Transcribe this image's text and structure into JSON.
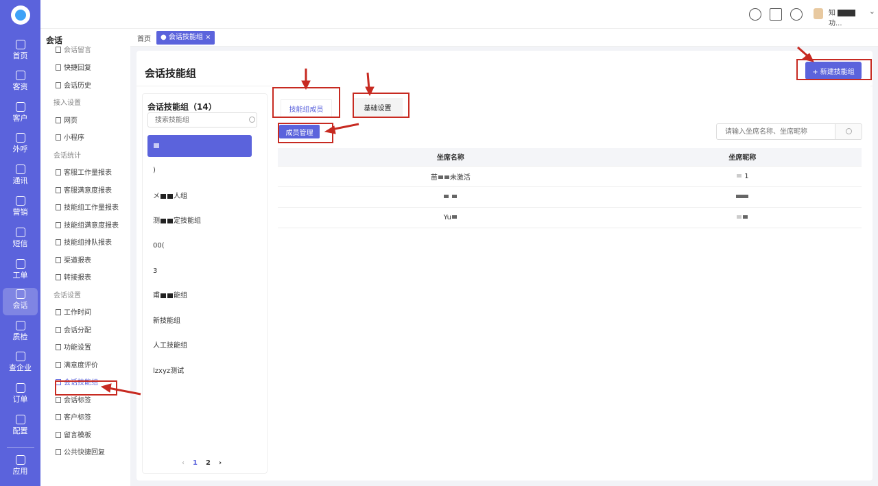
{
  "rail": {
    "items": [
      {
        "label": "首页",
        "icon": "home-icon"
      },
      {
        "label": "客资",
        "icon": "customers-icon"
      },
      {
        "label": "客户",
        "icon": "customer-icon"
      },
      {
        "label": "外呼",
        "icon": "phone-icon"
      },
      {
        "label": "通讯",
        "icon": "contacts-icon"
      },
      {
        "label": "营销",
        "icon": "marketing-icon"
      },
      {
        "label": "短信",
        "icon": "sms-icon"
      },
      {
        "label": "工单",
        "icon": "ticket-icon"
      },
      {
        "label": "会话",
        "icon": "chat-icon"
      },
      {
        "label": "质检",
        "icon": "quality-icon"
      },
      {
        "label": "查企业",
        "icon": "company-icon"
      },
      {
        "label": "订单",
        "icon": "order-icon"
      },
      {
        "label": "配置",
        "icon": "config-icon"
      },
      {
        "label": "应用",
        "icon": "apps-icon"
      }
    ],
    "active_index": 8
  },
  "topbar": {
    "user_suffix": "功...",
    "user_initial": "知",
    "user_initial2": "上"
  },
  "subsidebar": {
    "title": "会话",
    "partial_top": "会话留言",
    "items": [
      {
        "type": "item",
        "label": "快捷回复"
      },
      {
        "type": "item",
        "label": "会话历史"
      },
      {
        "type": "group",
        "label": "接入设置"
      },
      {
        "type": "item",
        "label": "网页"
      },
      {
        "type": "item",
        "label": "小程序"
      },
      {
        "type": "group",
        "label": "会话统计"
      },
      {
        "type": "item",
        "label": "客服工作量报表"
      },
      {
        "type": "item",
        "label": "客服满意度报表"
      },
      {
        "type": "item",
        "label": "技能组工作量报表"
      },
      {
        "type": "item",
        "label": "技能组满意度报表"
      },
      {
        "type": "item",
        "label": "技能组排队报表"
      },
      {
        "type": "item",
        "label": "渠道报表"
      },
      {
        "type": "item",
        "label": "转接报表"
      },
      {
        "type": "group",
        "label": "会话设置"
      },
      {
        "type": "item",
        "label": "工作时间"
      },
      {
        "type": "item",
        "label": "会话分配"
      },
      {
        "type": "item",
        "label": "功能设置"
      },
      {
        "type": "item",
        "label": "满意度评价"
      },
      {
        "type": "item",
        "label": "会话技能组",
        "active": true
      },
      {
        "type": "item",
        "label": "会话标签"
      },
      {
        "type": "item",
        "label": "客户标签"
      },
      {
        "type": "item",
        "label": "留言模板"
      },
      {
        "type": "item",
        "label": "公共快捷回复"
      }
    ]
  },
  "tabs": {
    "home": "首页",
    "current": "会话技能组",
    "current_close": "×"
  },
  "page": {
    "title": "会话技能组",
    "new_button": "+ 新建技能组"
  },
  "group_panel": {
    "title": "会话技能组（14）",
    "search_placeholder": "搜索技能组",
    "items": [
      {
        "label": "",
        "active": true
      },
      {
        "label": ")"
      },
      {
        "label": "人组",
        "prefix": "メ"
      },
      {
        "label": "定技能组",
        "prefix": "测"
      },
      {
        "label": "00("
      },
      {
        "label": "3"
      },
      {
        "label": "能组",
        "prefix": "甫"
      },
      {
        "label": "新技能组"
      },
      {
        "label": "人工技能组"
      },
      {
        "label": "lzxyz测试"
      }
    ],
    "pagination": {
      "prev": "‹",
      "pages": [
        "1",
        "2"
      ],
      "next": "›"
    }
  },
  "detail": {
    "tab_members": "技能组成员",
    "tab_basic": "基础设置",
    "member_manage": "成员管理",
    "agent_search_placeholder": "请输入坐席名称、坐席昵称",
    "columns": [
      "坐席名称",
      "坐席昵称"
    ],
    "rows": [
      {
        "name_prefix": "苗",
        "name_suffix": "未激活",
        "nick_suffix": "1"
      },
      {
        "name_prefix": "",
        "name_suffix": "",
        "nick_suffix": ""
      },
      {
        "name_prefix": "Yu",
        "name_suffix": "",
        "nick_suffix": ""
      }
    ]
  },
  "colors": {
    "accent": "#5b63dc",
    "annotation": "#c72a21"
  }
}
